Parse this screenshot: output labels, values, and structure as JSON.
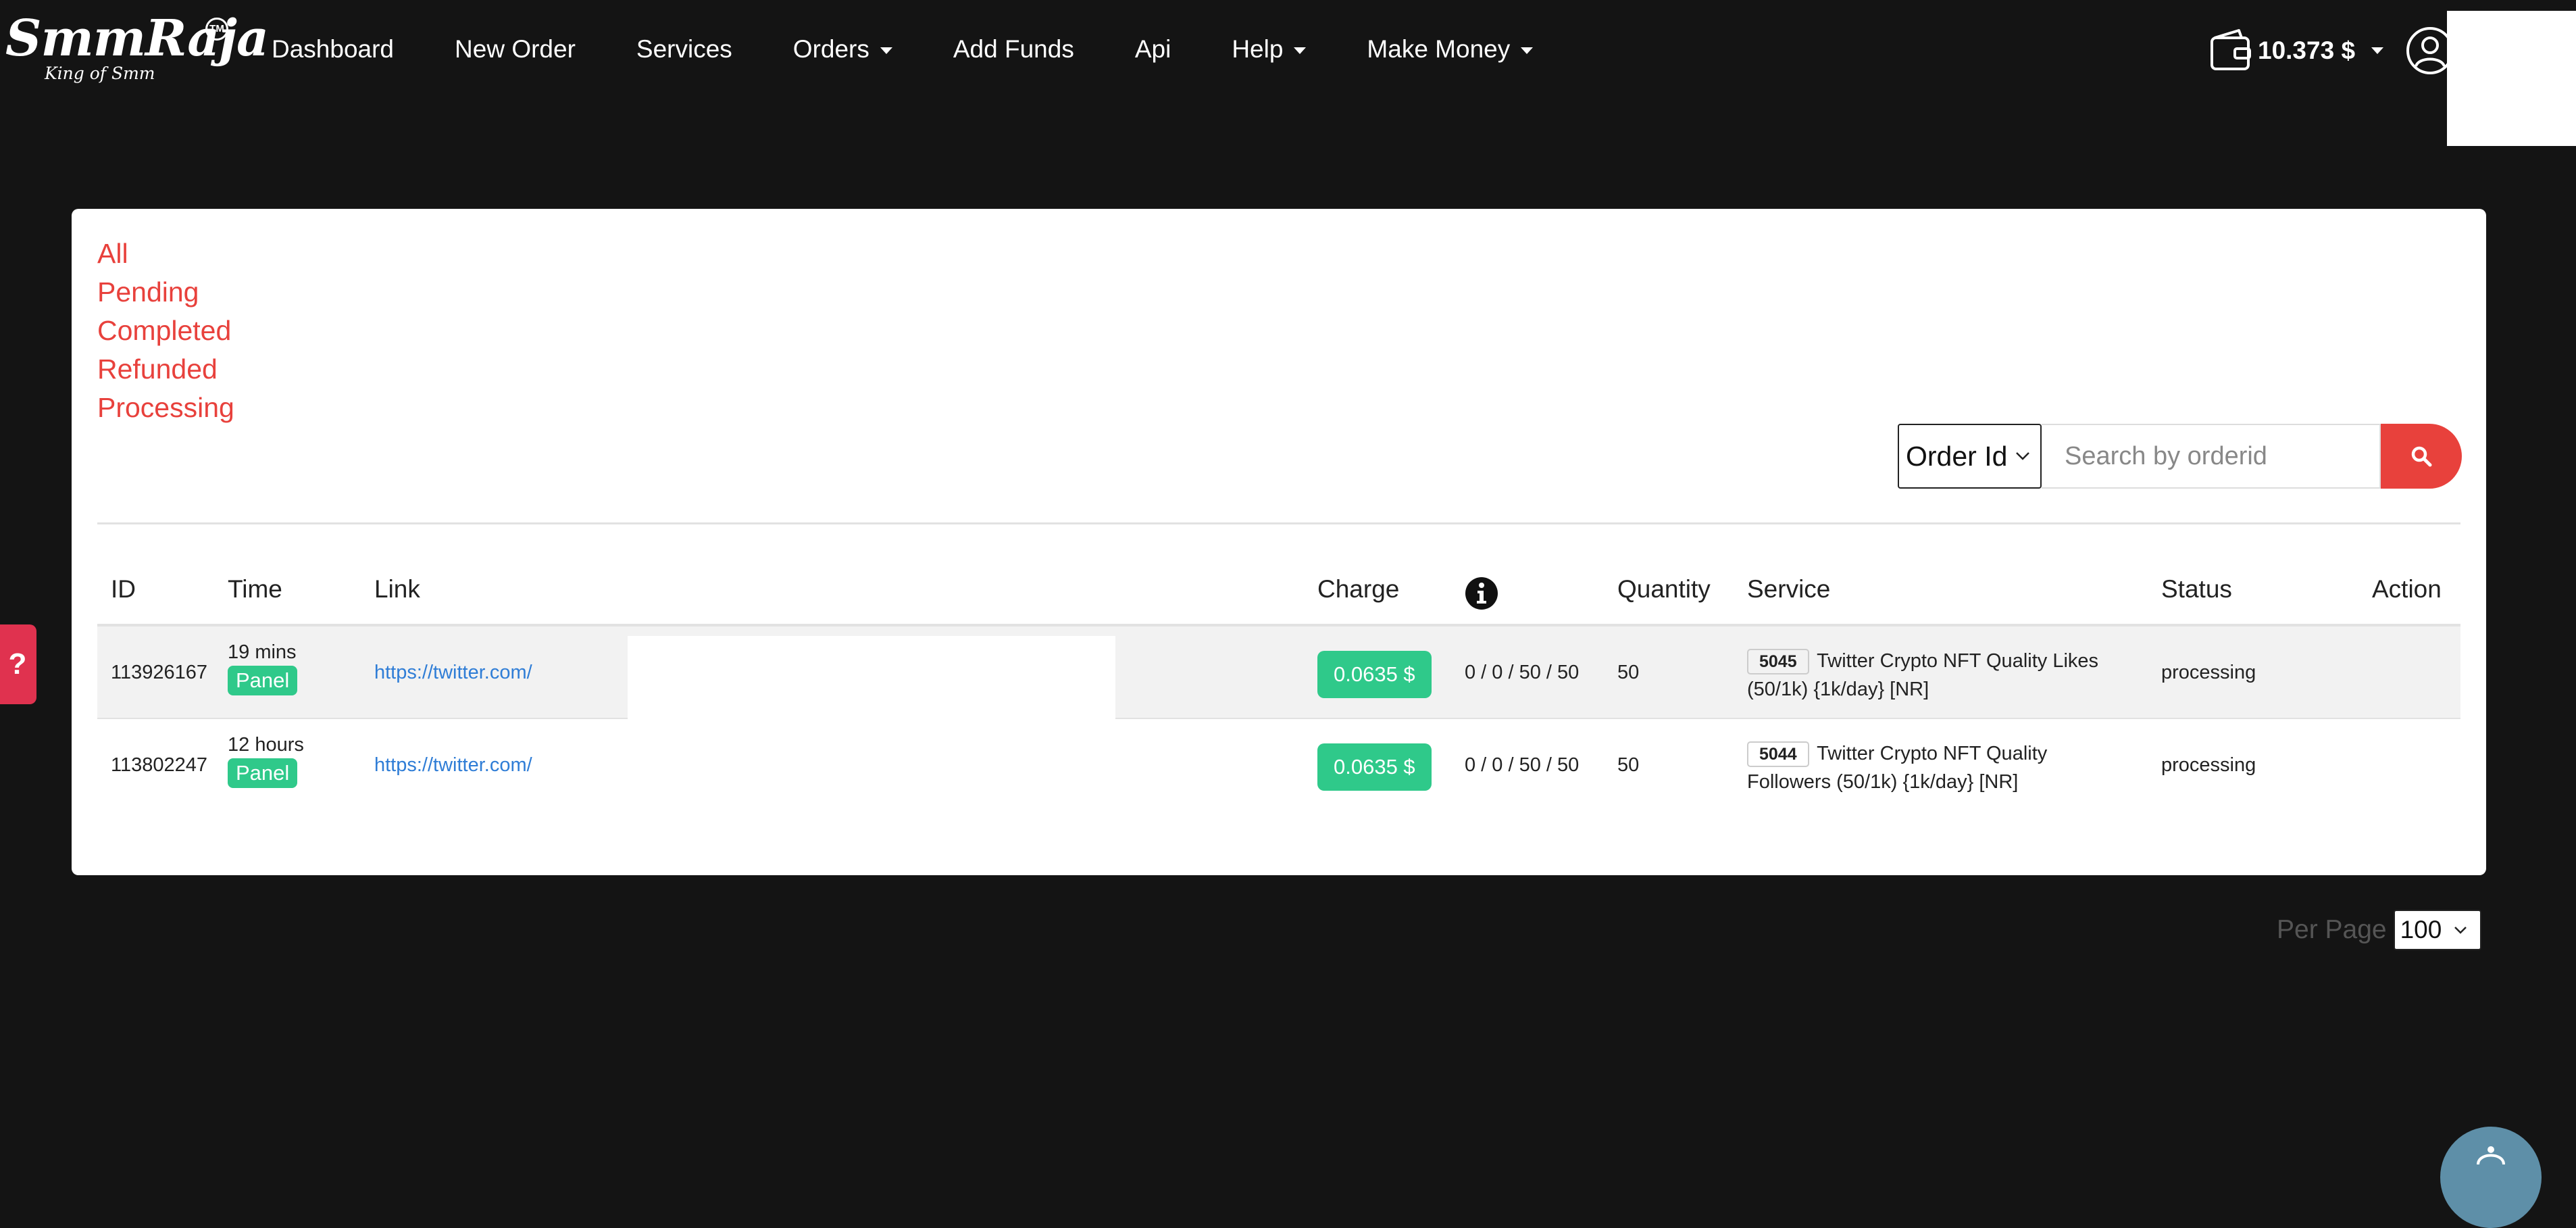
{
  "logo": {
    "name": "SmmRaja",
    "tagline": "King of Smm",
    "trademark": "TM"
  },
  "nav": {
    "links": [
      {
        "label": "Dashboard",
        "dropdown": false
      },
      {
        "label": "New Order",
        "dropdown": false
      },
      {
        "label": "Services",
        "dropdown": false
      },
      {
        "label": "Orders",
        "dropdown": true
      },
      {
        "label": "Add Funds",
        "dropdown": false
      },
      {
        "label": "Api",
        "dropdown": false
      },
      {
        "label": "Help",
        "dropdown": true
      },
      {
        "label": "Make Money",
        "dropdown": true
      }
    ],
    "balance": "10.373 $"
  },
  "filters": [
    "All",
    "Pending",
    "Completed",
    "Refunded",
    "Processing"
  ],
  "search": {
    "type_selected": "Order Id",
    "placeholder": "Search by orderid"
  },
  "table": {
    "headers": {
      "id": "ID",
      "time": "Time",
      "link": "Link",
      "charge": "Charge",
      "quantity": "Quantity",
      "service": "Service",
      "status": "Status",
      "action": "Action"
    },
    "rows": [
      {
        "id": "113926167",
        "time": "19 mins",
        "badge": "Panel",
        "link": "https://twitter.com/",
        "charge": "0.0635 $",
        "progress": "0 / 0 / 50 / 50",
        "quantity": "50",
        "service_id": "5045",
        "service_name": "Twitter Crypto NFT Quality Likes (50/1k) {1k/day} [NR]",
        "status": "processing"
      },
      {
        "id": "113802247",
        "time": "12 hours",
        "badge": "Panel",
        "link": "https://twitter.com/",
        "charge": "0.0635 $",
        "progress": "0 / 0 / 50 / 50",
        "quantity": "50",
        "service_id": "5044",
        "service_name": "Twitter Crypto NFT Quality Followers (50/1k) {1k/day} [NR]",
        "status": "processing"
      }
    ]
  },
  "pagination": {
    "per_page_label": "Per Page",
    "per_page_value": "100"
  },
  "help_tab": "?",
  "colors": {
    "accent": "#e8413c",
    "success": "#2fc98a",
    "link": "#2f7dd6",
    "background": "#141414"
  }
}
